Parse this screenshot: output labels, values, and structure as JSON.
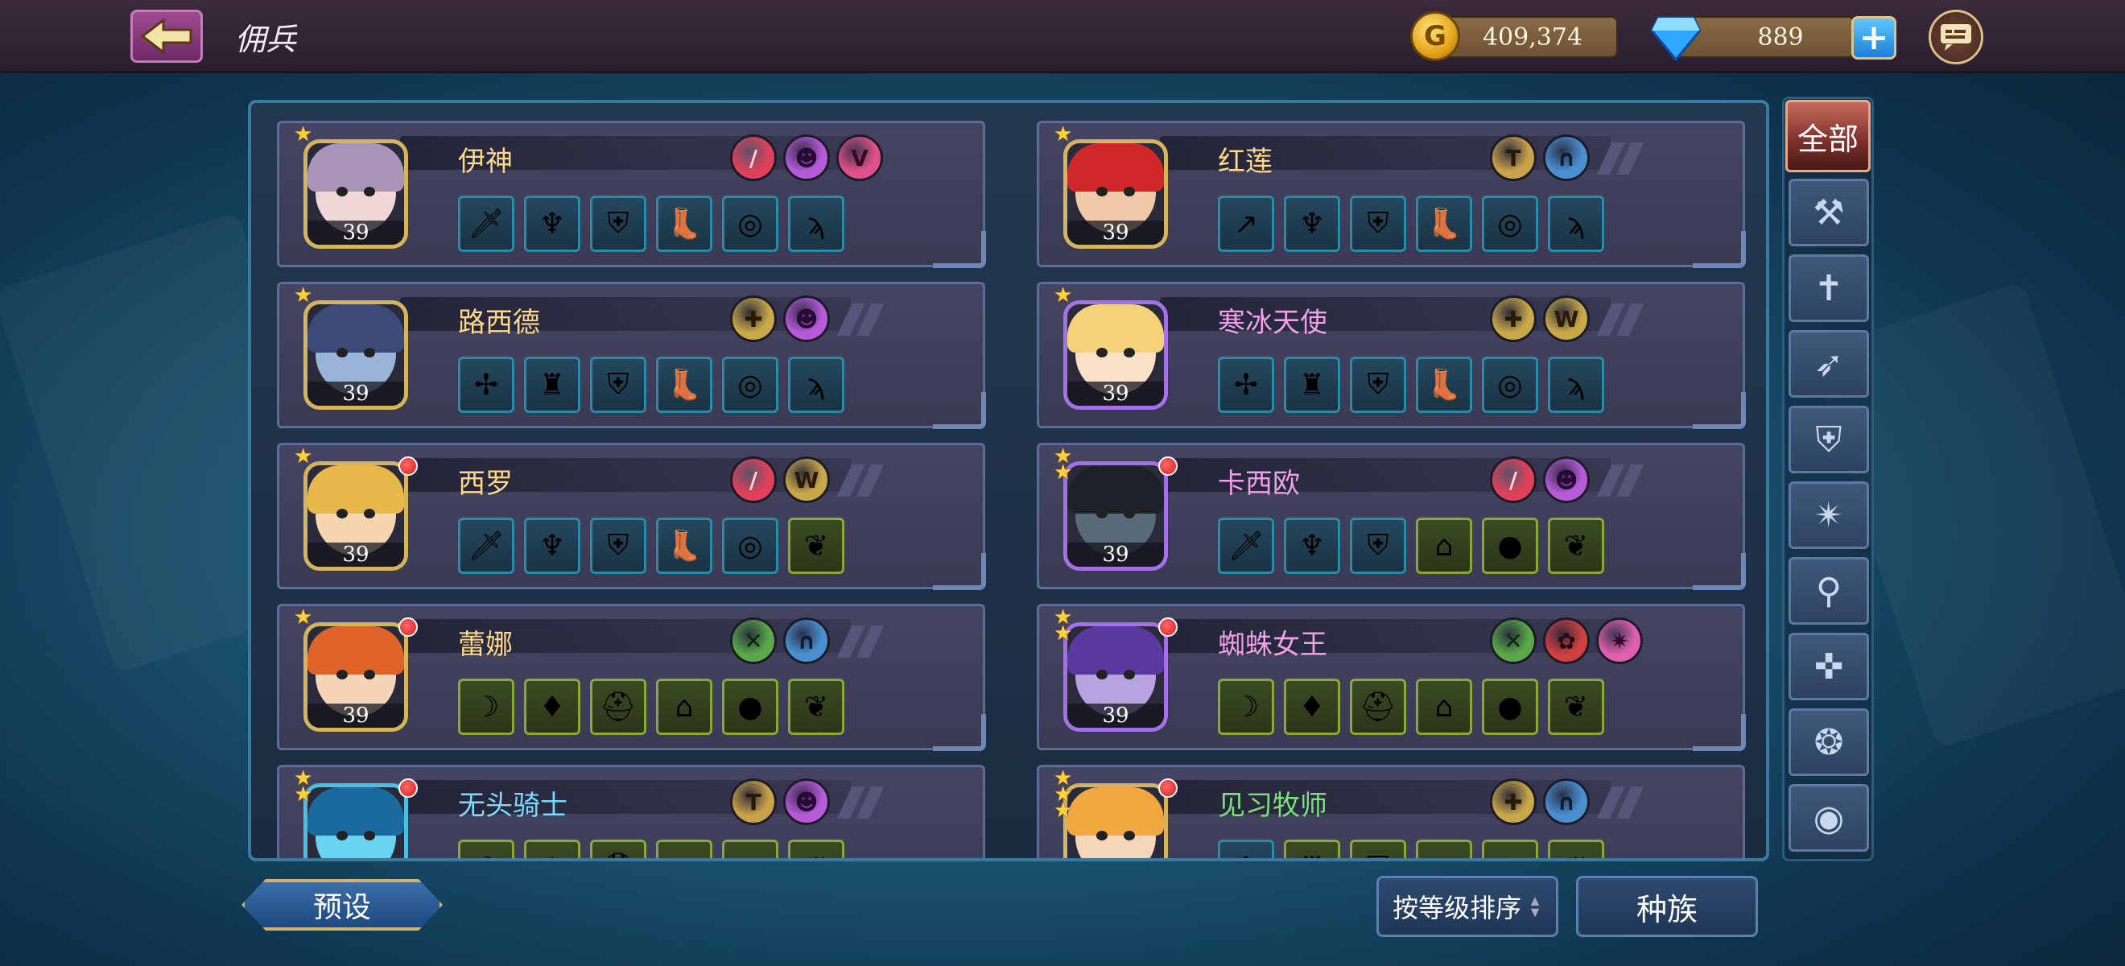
{
  "header": {
    "title": "佣兵",
    "gold": "409,374",
    "gems": "889",
    "coin_symbol": "G"
  },
  "colors": {
    "accent_gold": "#d4b45c",
    "accent_purple": "#a370e6",
    "filter_active": "#7a2f2a"
  },
  "heroes": [
    {
      "name": "伊神",
      "level": "39",
      "stars": 1,
      "notify": false,
      "portrait": "purple-hair-girl",
      "frame": "gold",
      "name_color": "gold",
      "badges": [
        "red-stripes-badge",
        "purple-demon-badge",
        "pink-chevron-badge"
      ],
      "equips": [
        "dagger-icon",
        "demon-helmet-icon",
        "gold-armor-icon",
        "boot-icon",
        "ring-icon",
        "claw-icon"
      ],
      "equip_tiers": [
        "blue",
        "blue",
        "blue",
        "blue",
        "blue",
        "blue"
      ]
    },
    {
      "name": "红莲",
      "level": "39",
      "stars": 1,
      "notify": false,
      "portrait": "red-hair-warrior",
      "frame": "gold",
      "name_color": "gold",
      "badges": [
        "gold-shield-badge",
        "blue-helmet-badge"
      ],
      "equips": [
        "spear-icon",
        "demon-helmet-icon",
        "gold-armor-icon",
        "boot-icon",
        "ring-icon",
        "claw-icon"
      ],
      "equip_tiers": [
        "blue",
        "blue",
        "blue",
        "blue",
        "blue",
        "blue"
      ]
    },
    {
      "name": "路西德",
      "level": "39",
      "stars": 1,
      "notify": false,
      "portrait": "blue-skin-elf",
      "frame": "gold",
      "name_color": "gold",
      "badges": [
        "gold-cross-badge",
        "purple-demon-badge"
      ],
      "equips": [
        "purple-axe-icon",
        "purple-armor-icon",
        "gold-armor-icon",
        "boot-icon",
        "ring-icon",
        "claw-icon"
      ],
      "equip_tiers": [
        "blue",
        "blue",
        "blue",
        "blue",
        "blue",
        "blue"
      ]
    },
    {
      "name": "寒冰天使",
      "level": "39",
      "stars": 1,
      "notify": false,
      "portrait": "blonde-angel",
      "frame": "purple",
      "name_color": "pink",
      "badges": [
        "gold-cross-badge",
        "gold-wings-badge"
      ],
      "equips": [
        "purple-axe-icon",
        "purple-armor-icon",
        "gold-armor-icon",
        "boot-icon",
        "ring-icon",
        "claw-icon"
      ],
      "equip_tiers": [
        "blue",
        "blue",
        "blue",
        "blue",
        "blue",
        "blue"
      ]
    },
    {
      "name": "西罗",
      "level": "39",
      "stars": 1,
      "notify": true,
      "portrait": "blonde-elf",
      "frame": "gold",
      "name_color": "gold",
      "badges": [
        "red-stripes-badge",
        "gold-wings-badge"
      ],
      "equips": [
        "dagger-icon",
        "demon-helmet-icon",
        "gold-armor-icon",
        "boot-icon",
        "ring-icon",
        "amulet-icon"
      ],
      "equip_tiers": [
        "blue",
        "blue",
        "blue",
        "blue",
        "blue",
        "green"
      ]
    },
    {
      "name": "卡西欧",
      "level": "39",
      "stars": 2,
      "notify": true,
      "portrait": "dark-knight",
      "frame": "purple",
      "name_color": "pink",
      "badges": [
        "red-stripes-badge",
        "purple-demon-badge"
      ],
      "equips": [
        "dagger-icon",
        "demon-helmet-icon",
        "gold-armor-icon",
        "hat-icon",
        "ruby-ring-icon",
        "amulet-icon"
      ],
      "equip_tiers": [
        "blue",
        "blue",
        "blue",
        "green",
        "green",
        "green"
      ]
    },
    {
      "name": "蕾娜",
      "level": "39",
      "stars": 1,
      "notify": true,
      "portrait": "red-hair-ranger",
      "frame": "gold",
      "name_color": "gold",
      "badges": [
        "green-bow-badge",
        "blue-helmet-badge"
      ],
      "equips": [
        "bow-icon",
        "blue-armor-icon",
        "iron-helmet-icon",
        "hat-icon",
        "ruby-ring-icon",
        "amulet-icon"
      ],
      "equip_tiers": [
        "green",
        "green",
        "green",
        "green",
        "green",
        "green"
      ]
    },
    {
      "name": "蜘蛛女王",
      "level": "39",
      "stars": 2,
      "notify": true,
      "portrait": "spider-queen",
      "frame": "purple",
      "name_color": "pink",
      "badges": [
        "green-bow-badge",
        "red-paw-badge",
        "pink-spider-badge"
      ],
      "equips": [
        "bow-icon",
        "blue-armor-icon",
        "iron-helmet-icon",
        "hat-icon",
        "ruby-ring-icon",
        "amulet-icon"
      ],
      "equip_tiers": [
        "green",
        "green",
        "green",
        "green",
        "green",
        "green"
      ]
    },
    {
      "name": "无头骑士",
      "level": "",
      "stars": 2,
      "notify": true,
      "portrait": "headless-knight",
      "frame": "cyan",
      "name_color": "cyan",
      "badges": [
        "gold-shield-badge",
        "purple-demon-badge"
      ],
      "equips": [
        "bow-icon",
        "blue-armor-icon",
        "iron-helmet-icon",
        "hat-icon",
        "ruby-ring-icon",
        "amulet-icon"
      ],
      "equip_tiers": [
        "green",
        "green",
        "green",
        "green",
        "green",
        "green"
      ]
    },
    {
      "name": "见习牧师",
      "level": "",
      "stars": 3,
      "notify": true,
      "portrait": "blonde-priest",
      "frame": "gold",
      "name_color": "green",
      "badges": [
        "gold-cross-badge",
        "blue-helmet-badge"
      ],
      "equips": [
        "purple-axe-icon",
        "purple-armor-icon",
        "gold-armor-icon",
        "hat-icon",
        "ruby-ring-icon",
        "amulet-icon"
      ],
      "equip_tiers": [
        "blue",
        "green",
        "green",
        "green",
        "green",
        "green"
      ]
    }
  ],
  "filters": {
    "all_label": "全部",
    "icons": [
      "hammer-icon",
      "staff-icon",
      "bow-icon",
      "shield-icon",
      "shuriken-icon",
      "axe-icon",
      "cross-icon",
      "claw-icon",
      "orb-icon"
    ]
  },
  "bottom": {
    "preset_label": "预设",
    "sort_label": "按等级排序",
    "race_label": "种族"
  }
}
